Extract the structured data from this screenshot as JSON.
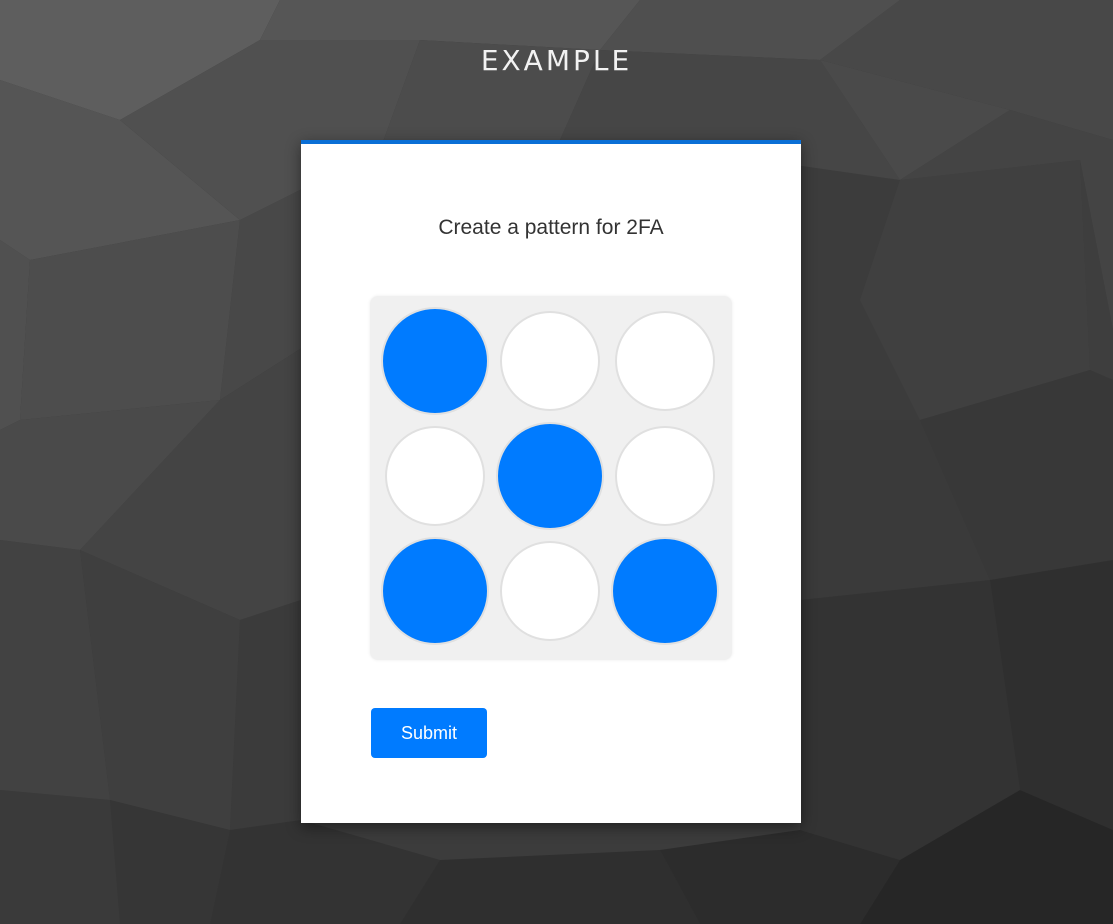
{
  "header": {
    "brand": "EXAMPLE"
  },
  "card": {
    "title": "Create a pattern for 2FA",
    "submit_label": "Submit"
  },
  "pattern": {
    "rows": 3,
    "cols": 3,
    "selected": [
      [
        true,
        false,
        false
      ],
      [
        false,
        true,
        false
      ],
      [
        true,
        false,
        true
      ]
    ]
  },
  "colors": {
    "accent": "#007bff",
    "card_top_border": "#0a6fd6",
    "unselected_dot": "#ffffff",
    "grid_background": "#f0f0f0"
  }
}
